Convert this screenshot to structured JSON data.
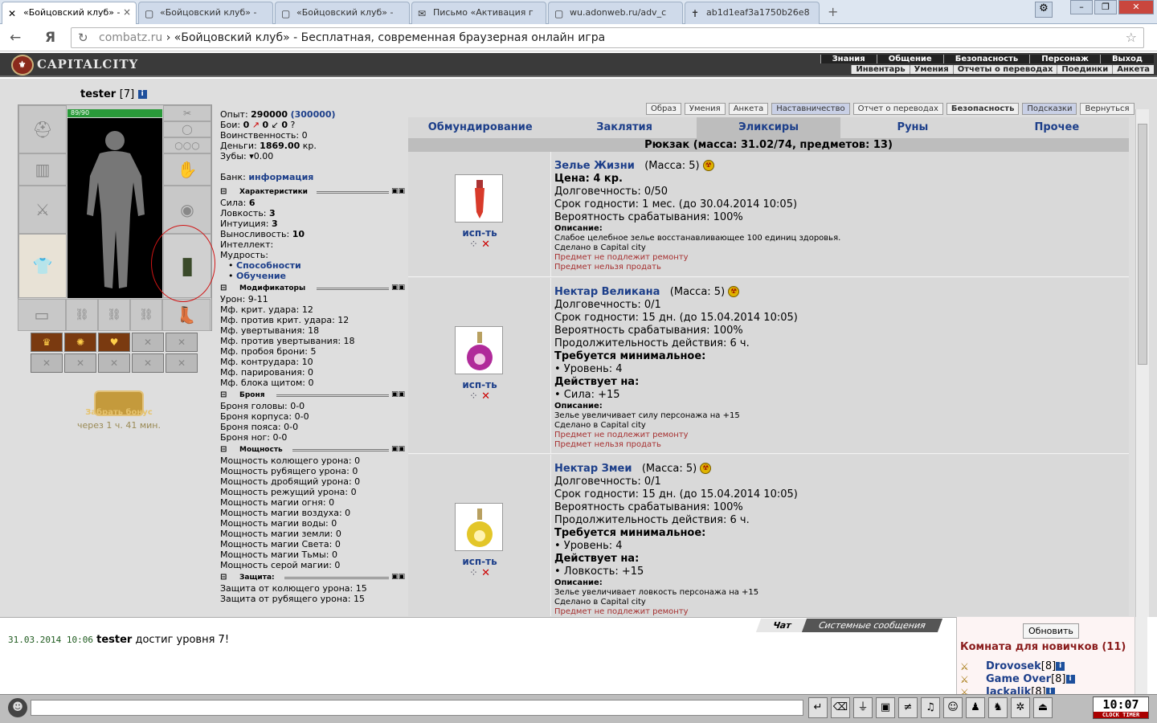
{
  "browser": {
    "tabs": [
      {
        "icon": "✕",
        "label": "«Бойцовский клуб» -",
        "close": "×"
      },
      {
        "icon": "▢",
        "label": "«Бойцовский клуб» -",
        "close": ""
      },
      {
        "icon": "▢",
        "label": "«Бойцовский клуб» -",
        "close": ""
      },
      {
        "icon": "✉",
        "label": "Письмо «Активация г",
        "close": ""
      },
      {
        "icon": "▢",
        "label": "wu.adonweb.ru/adv_c",
        "close": ""
      },
      {
        "icon": "✝",
        "label": "ab1d1eaf3a1750b26e8",
        "close": ""
      }
    ],
    "new_tab": "+",
    "back": "←",
    "yandex": "Я",
    "reload": "↻",
    "url_domain": "combatz.ru",
    "url_title": " › «Бойцовский клуб» - Бесплатная, современная браузерная онлайн игра",
    "star": "☆"
  },
  "game": {
    "logo": "CAPITALCITY",
    "menu_top": [
      "Знания",
      "Общение",
      "Безопасность",
      "Персонаж",
      "Выход"
    ],
    "menu_sub": [
      "Инвентарь",
      "Умения",
      "Отчеты о переводах",
      "Поединки",
      "Анкета"
    ],
    "char_name": "tester",
    "char_level": "[7]",
    "hp": "89/90",
    "bonus_label": "Забрать бонус",
    "bonus_time": "через 1 ч. 41 мин.",
    "stats": {
      "exp_label": "Опыт:",
      "exp": "290000",
      "exp_next": "(300000)",
      "fights_label": "Бои:",
      "fights_w": "0",
      "fights_l": "0",
      "fights_d": "0",
      "valor": "Воинственность: 0",
      "money_label": "Деньги:",
      "money": "1869.00",
      "money_unit": "кр.",
      "teeth_label": "Зубы:",
      "teeth": "0.00",
      "bank_label": "Банк:",
      "bank_link": "информация"
    },
    "sections": {
      "chars": "Характеристики",
      "mods": "Модификаторы",
      "armor": "Броня",
      "power": "Мощность",
      "defense": "Защита:"
    },
    "characteristics": [
      {
        "k": "Сила:",
        "v": "6"
      },
      {
        "k": "Ловкость:",
        "v": "3"
      },
      {
        "k": "Интуиция:",
        "v": "3"
      },
      {
        "k": "Выносливость:",
        "v": "10"
      },
      {
        "k": "Интеллект:",
        "v": ""
      },
      {
        "k": "Мудрость:",
        "v": ""
      }
    ],
    "links": [
      "Способности",
      "Обучение"
    ],
    "modifiers": [
      "Урон: 9-11",
      "Мф. крит. удара: 12",
      "Мф. против крит. удара: 12",
      "Мф. увертывания: 18",
      "Мф. против увертывания: 18",
      "Мф. пробоя брони: 5",
      "Мф. контрудара: 10",
      "Мф. парирования: 0",
      "Мф. блока щитом: 0"
    ],
    "armor": [
      "Броня головы: 0-0",
      "Броня корпуса: 0-0",
      "Броня пояса: 0-0",
      "Броня ног: 0-0"
    ],
    "power": [
      "Мощность колющего урона: 0",
      "Мощность рубящего урона: 0",
      "Мощность дробящий урона: 0",
      "Мощность режущий урона: 0",
      "Мощность магии огня: 0",
      "Мощность магии воздуха: 0",
      "Мощность магии воды: 0",
      "Мощность магии земли: 0",
      "Мощность магии Света: 0",
      "Мощность магии Тьмы: 0",
      "Мощность серой магии: 0"
    ],
    "defense": [
      "Защита от колющего урона: 15",
      "Защита от рубящего урона: 15"
    ],
    "top_tabs": [
      "Образ",
      "Умения",
      "Анкета",
      "Наставничество",
      "Отчет о переводах",
      "Безопасность",
      "Подсказки",
      "Вернуться"
    ],
    "cat_tabs": [
      "Обмундирование",
      "Заклятия",
      "Эликсиры",
      "Руны",
      "Прочее"
    ],
    "backpack": "Рюкзак (масса: 31.02/74, предметов: 13)",
    "use_label": "исп-ть",
    "items": [
      {
        "name": "Зелье Жизни",
        "mass": "(Масса: 5)",
        "lines": [
          "Цена: 4 кр.",
          "Долговечность: 0/50",
          "Срок годности: 1 мес. (до 30.04.2014 10:05)",
          "Вероятность срабатывания: 100%"
        ],
        "desc_label": "Описание:",
        "desc": [
          "Слабое целебное зелье восстанавливающее 100 единиц здоровья.",
          "Сделано в Capital city"
        ],
        "red": [
          "Предмет не подлежит ремонту",
          "Предмет нельзя продать"
        ]
      },
      {
        "name": "Нектар Великана",
        "mass": "(Масса: 5)",
        "lines": [
          "Долговечность: 0/1",
          "Срок годности: 15 дн. (до 15.04.2014 10:05)",
          "Вероятность срабатывания: 100%",
          "Продолжительность действия: 6 ч."
        ],
        "req_label": "Требуется минимальное:",
        "req": "• Уровень: 4",
        "eff_label": "Действует на:",
        "eff": "• Сила: +15",
        "desc_label": "Описание:",
        "desc": [
          "Зелье увеличивает силу персонажа на +15",
          "Сделано в Capital city"
        ],
        "red": [
          "Предмет не подлежит ремонту",
          "Предмет нельзя продать"
        ]
      },
      {
        "name": "Нектар Змеи",
        "mass": "(Масса: 5)",
        "lines": [
          "Долговечность: 0/1",
          "Срок годности: 15 дн. (до 15.04.2014 10:05)",
          "Вероятность срабатывания: 100%",
          "Продолжительность действия: 6 ч."
        ],
        "req_label": "Требуется минимальное:",
        "req": "• Уровень: 4",
        "eff_label": "Действует на:",
        "eff": "• Ловкость: +15",
        "desc_label": "Описание:",
        "desc": [
          "Зелье увеличивает ловкость персонажа на +15",
          "Сделано в Capital city"
        ],
        "red": [
          "Предмет не подлежит ремонту"
        ]
      }
    ],
    "chat": {
      "time": "31.03.2014 10:06",
      "user": "tester",
      "msg": " достиг уровня 7!",
      "tabs": [
        "Чат",
        "Системные сообщения"
      ],
      "refresh": "Обновить",
      "room": "Комната для новичков (11)",
      "users": [
        {
          "name": "Drovosek",
          "lvl": "[8]"
        },
        {
          "name": "Game Over",
          "lvl": "[8]"
        },
        {
          "name": "Jackalik",
          "lvl": "[8]"
        }
      ]
    },
    "clock": {
      "time": "10:07",
      "label": "CLOCK TIMER"
    },
    "colors": {
      "accent": "#1d3f8a",
      "hp": "#2a9a3a",
      "warn": "#a63030"
    }
  }
}
